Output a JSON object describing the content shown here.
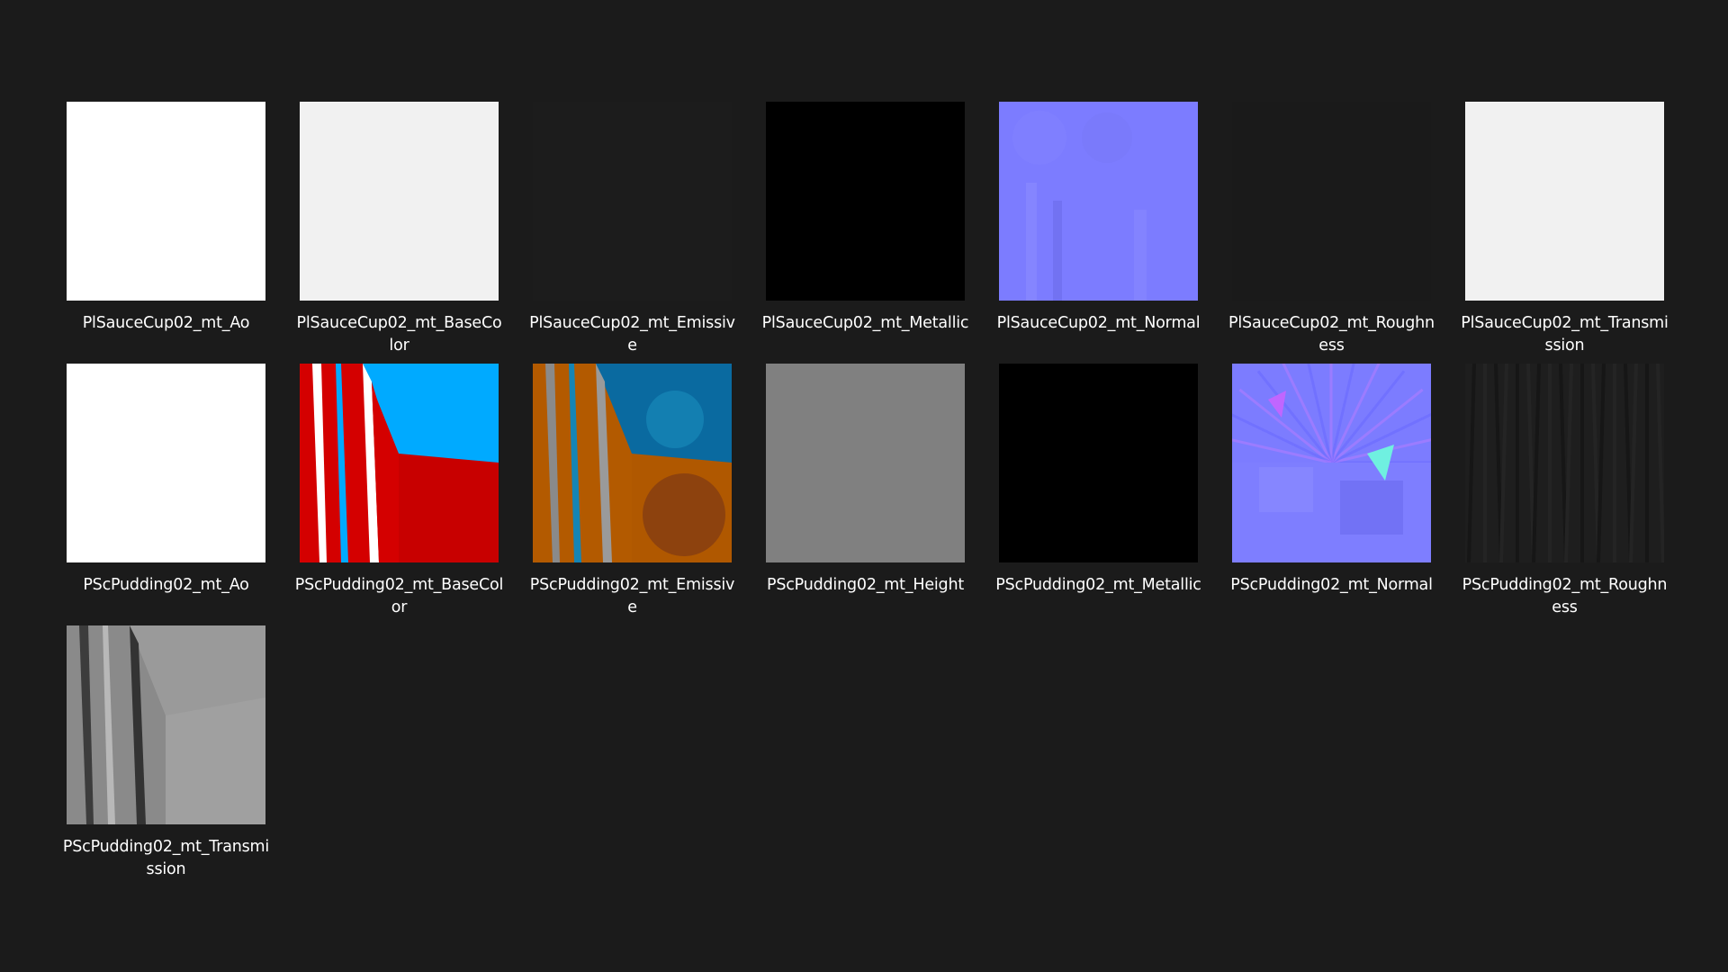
{
  "colors": {
    "background": "#1b1b1b",
    "label_text": "#ffffff"
  },
  "thumbnails": [
    {
      "label": "PlSauceCup02_mt_Ao",
      "preview": "solid",
      "color": "#ffffff"
    },
    {
      "label": "PlSauceCup02_mt_BaseColor",
      "preview": "solid",
      "color": "#f1f1f1"
    },
    {
      "label": "PlSauceCup02_mt_Emissive",
      "preview": "solid",
      "color": "#1c1c1c"
    },
    {
      "label": "PlSauceCup02_mt_Metallic",
      "preview": "solid",
      "color": "#000000"
    },
    {
      "label": "PlSauceCup02_mt_Normal",
      "preview": "normal-soft",
      "color": "#7f7fff"
    },
    {
      "label": "PlSauceCup02_mt_Roughness",
      "preview": "solid",
      "color": "#1a1a1a"
    },
    {
      "label": "PlSauceCup02_mt_Transmission",
      "preview": "solid",
      "color": "#f1f1f1"
    },
    {
      "label": "PScPudding02_mt_Ao",
      "preview": "solid",
      "color": "#ffffff"
    },
    {
      "label": "PScPudding02_mt_BaseColor",
      "preview": "basecolor",
      "color": "#00aaff"
    },
    {
      "label": "PScPudding02_mt_Emissive",
      "preview": "emissive",
      "color": "#0a6aa0"
    },
    {
      "label": "PScPudding02_mt_Height",
      "preview": "solid",
      "color": "#808080"
    },
    {
      "label": "PScPudding02_mt_Metallic",
      "preview": "solid",
      "color": "#000000"
    },
    {
      "label": "PScPudding02_mt_Normal",
      "preview": "normal-busy",
      "color": "#7f7fff"
    },
    {
      "label": "PScPudding02_mt_Roughness",
      "preview": "rough-dark",
      "color": "#1e1e1e"
    },
    {
      "label": "PScPudding02_mt_Transmission",
      "preview": "transmission",
      "color": "#9a9a9a"
    }
  ]
}
